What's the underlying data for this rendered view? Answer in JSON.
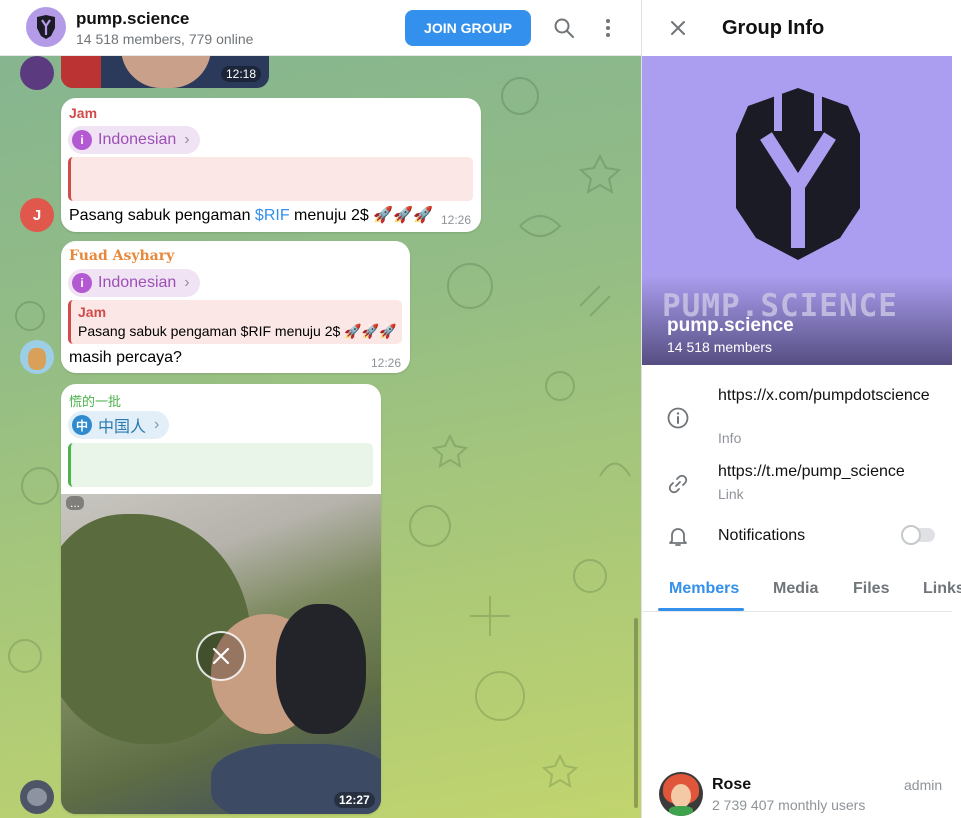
{
  "header": {
    "title": "pump.science",
    "subtitle": "14 518 members, 779 online",
    "join_label": "JOIN GROUP",
    "search_icon": "search-icon",
    "more_icon": "more-vert-icon",
    "accent": "#3390ec"
  },
  "messages": [
    {
      "type": "video-thumb",
      "time": "12:18"
    },
    {
      "sender": "Jam",
      "sender_color": "#d14b4b",
      "language": "Indonesian",
      "language_icon": "info-icon",
      "text_prefix": "Pasang sabuk pengaman ",
      "link": "$RIF",
      "text_suffix": " menuju 2$ 🚀🚀🚀",
      "time": "12:26",
      "avatar_initial": "J"
    },
    {
      "sender": "Fuad Asyhary",
      "sender_color": "#e8883a",
      "language": "Indonesian",
      "quote_sender": "Jam",
      "quote_text": "Pasang sabuk pengaman $RIF menuju 2$ 🚀🚀🚀",
      "text": "masih percaya?",
      "time": "12:26"
    },
    {
      "sender": "慌的一批",
      "sender_color": "#4bb34b",
      "language": "中国人",
      "language_badge": "中",
      "time": "12:27",
      "media_menu": "...",
      "media_icon": "close-icon"
    }
  ],
  "panel": {
    "title": "Group Info",
    "cover_wordmark": "PUMP.SCIENCE",
    "name": "pump.science",
    "members": "14 518 members",
    "info": [
      {
        "value": "https://x.com/pumpdotscience",
        "label": "Info",
        "icon": "info-icon"
      },
      {
        "value": "https://t.me/pump_science",
        "label": "Link",
        "icon": "link-icon"
      }
    ],
    "notifications_label": "Notifications",
    "notifications_on": false,
    "tabs": [
      "Members",
      "Media",
      "Files",
      "Links"
    ],
    "active_tab": "Members",
    "member": {
      "name": "Rose",
      "subtitle": "2 739 407 monthly users",
      "role": "admin"
    }
  }
}
